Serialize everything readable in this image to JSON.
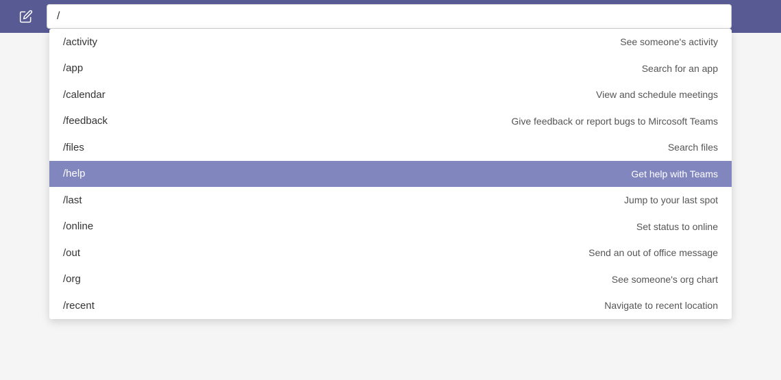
{
  "search": {
    "value": "/"
  },
  "commands": [
    {
      "label": "/activity",
      "desc": "See someone's activity",
      "selected": false
    },
    {
      "label": "/app",
      "desc": "Search for an app",
      "selected": false
    },
    {
      "label": "/calendar",
      "desc": "View and schedule meetings",
      "selected": false
    },
    {
      "label": "/feedback",
      "desc": "Give feedback or report bugs to Mircosoft Teams",
      "selected": false
    },
    {
      "label": "/files",
      "desc": "Search files",
      "selected": false
    },
    {
      "label": "/help",
      "desc": "Get help with Teams",
      "selected": true
    },
    {
      "label": "/last",
      "desc": "Jump to your last spot",
      "selected": false
    },
    {
      "label": "/online",
      "desc": "Set status to online",
      "selected": false
    },
    {
      "label": "/out",
      "desc": "Send an out of office message",
      "selected": false
    },
    {
      "label": "/org",
      "desc": "See someone's org chart",
      "selected": false
    },
    {
      "label": "/recent",
      "desc": "Navigate to recent location",
      "selected": false
    }
  ]
}
